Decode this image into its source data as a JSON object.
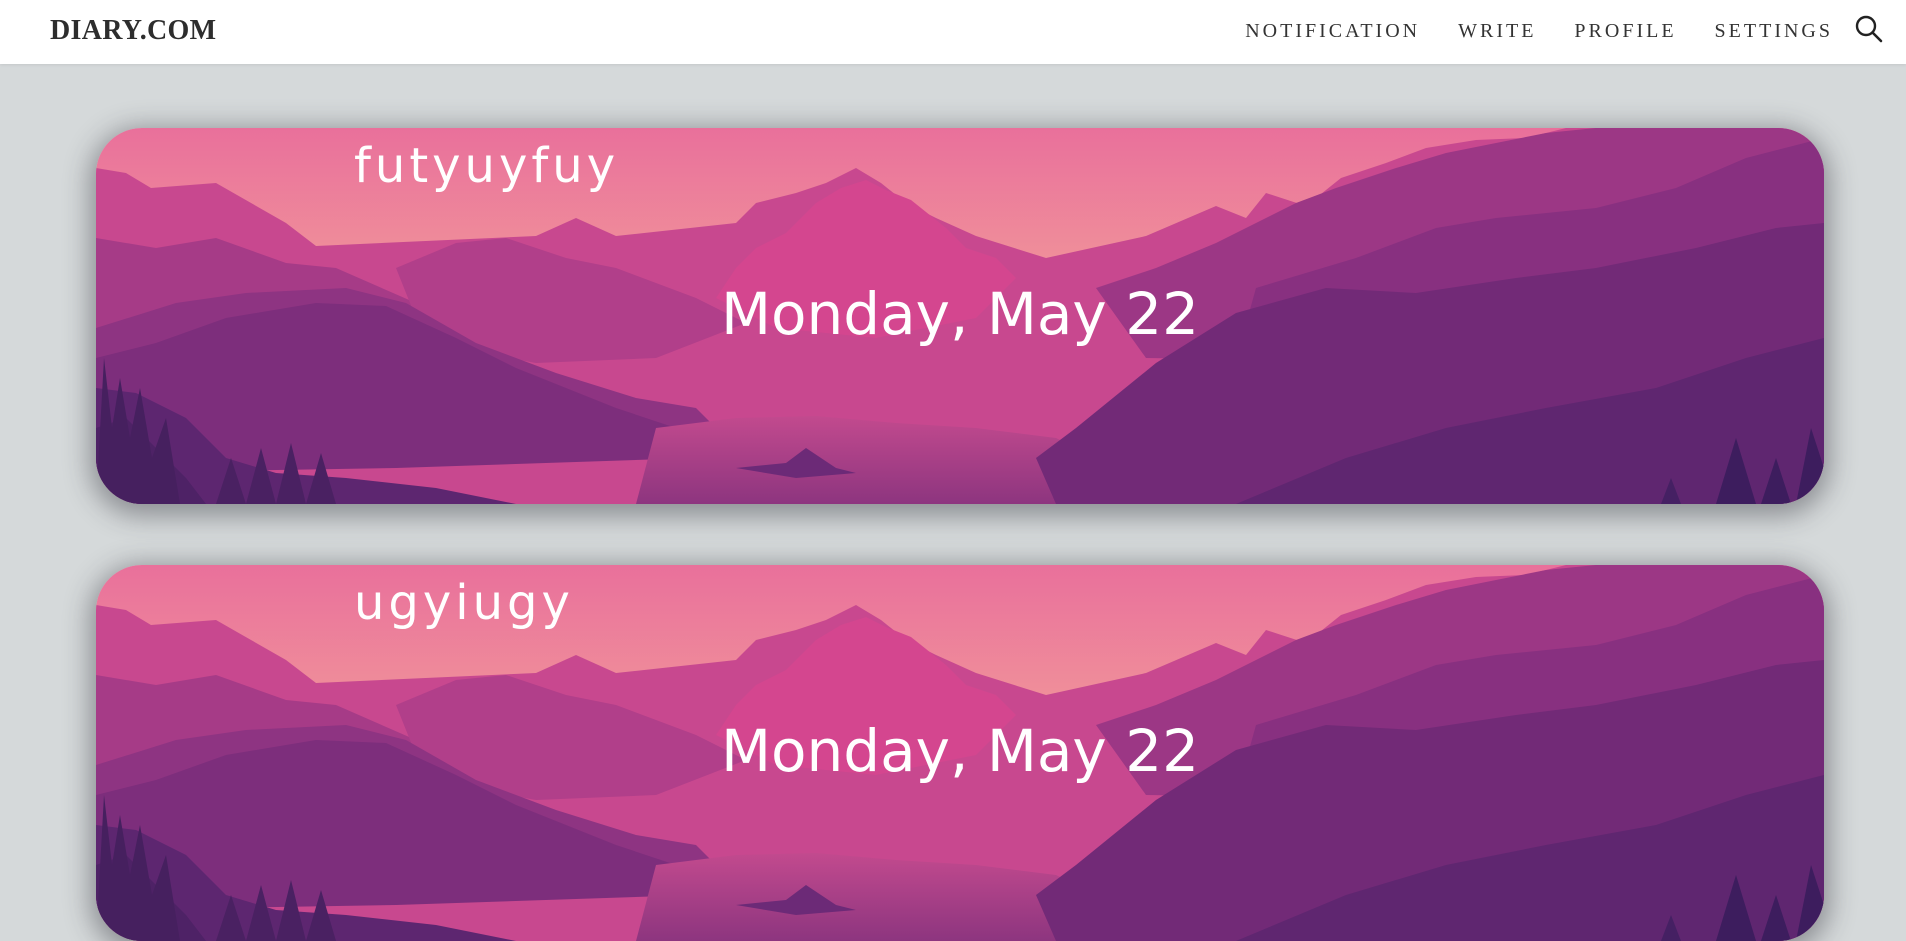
{
  "header": {
    "brand": "DIARY.COM",
    "nav": {
      "notification": "NOTIFICATION",
      "write": "WRITE",
      "profile": "PROFILE",
      "settings": "SETTINGS"
    },
    "search_icon": "search-icon"
  },
  "entries": [
    {
      "title": "futyuyfuy",
      "date": "Monday, May 22"
    },
    {
      "title": "ugyiugy",
      "date": "Monday, May 22"
    }
  ],
  "colors": {
    "page_background": "#d5d9da",
    "sky_top": "#e96f9a",
    "sky_horizon": "#f6b39a",
    "mountain_dark": "#5a2a6e",
    "text": "#ffffff"
  }
}
